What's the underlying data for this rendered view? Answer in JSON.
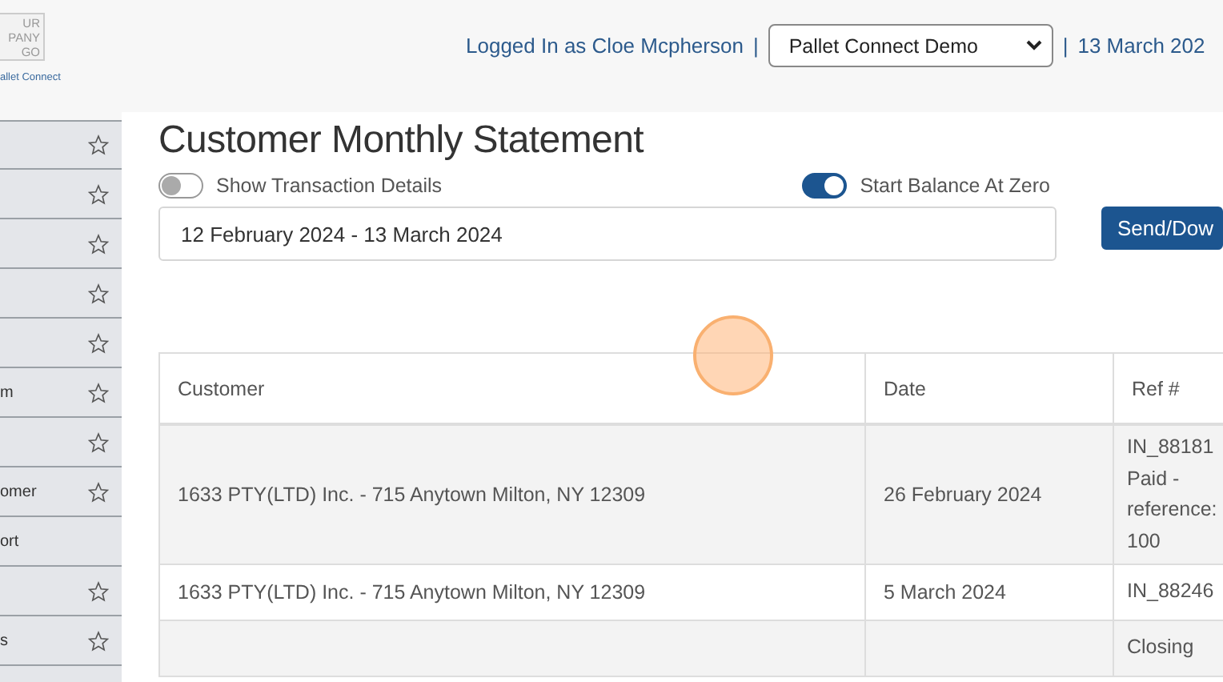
{
  "logo": {
    "lines": [
      "UR",
      "PANY",
      "GO"
    ],
    "caption": "allet Connect"
  },
  "header": {
    "user": "Logged In as Cloe Mcpherson",
    "separator": "|",
    "company": "Pallet Connect Demo",
    "date_separator": "|",
    "date": "13 March 202"
  },
  "sidebar": {
    "items": [
      {
        "star": true
      },
      {
        "star": true
      },
      {
        "star": true
      },
      {
        "star": true
      },
      {
        "star": true
      },
      {
        "label": "m",
        "star": true
      },
      {
        "star": true
      },
      {
        "label": "omer",
        "star": true
      },
      {
        "label": "ort",
        "star": false
      },
      {
        "star": true
      },
      {
        "label": "s",
        "star": true
      }
    ]
  },
  "page": {
    "title": "Customer Monthly Statement",
    "toggles": [
      {
        "label": "Show Transaction Details",
        "on": false
      },
      {
        "label": "Start Balance At Zero",
        "on": true
      }
    ],
    "date_range": "12 February 2024 - 13 March 2024",
    "send_button": "Send/Dow"
  },
  "table": {
    "columns": [
      "Customer",
      "Date",
      "Ref #"
    ],
    "rows": [
      {
        "customer": "1633 PTY(LTD) Inc. - 715 Anytown Milton, NY 12309",
        "date": "26 February 2024",
        "ref": [
          "IN_88181",
          "Paid -",
          "reference:",
          "100"
        ]
      },
      {
        "customer": "1633 PTY(LTD) Inc. - 715 Anytown Milton, NY 12309",
        "date": "5 March 2024",
        "ref": [
          "IN_88246"
        ]
      },
      {
        "ref": [
          "Closing"
        ]
      }
    ]
  }
}
